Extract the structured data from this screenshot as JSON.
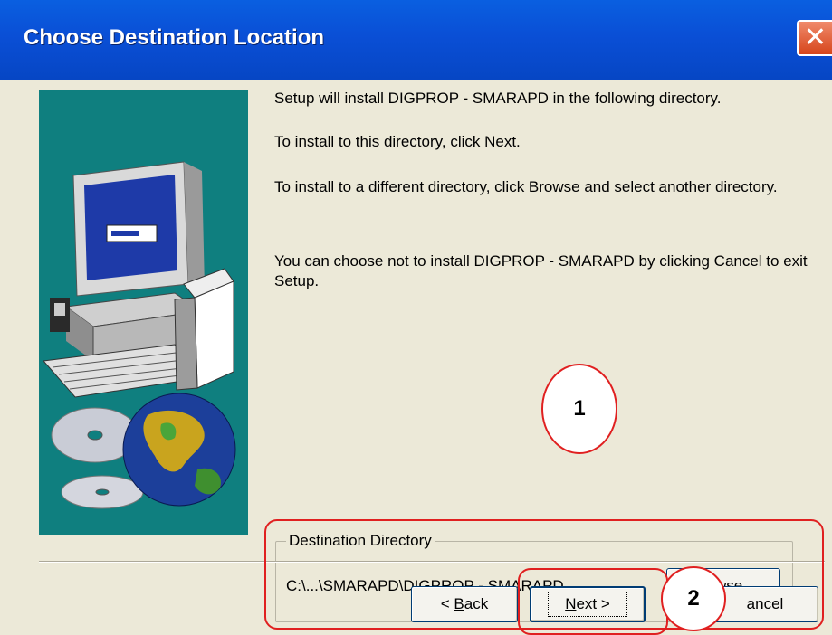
{
  "window": {
    "title": "Choose Destination Location",
    "close_glyph": "✕"
  },
  "description": {
    "line1": "Setup will install DIGPROP - SMARAPD in the following directory.",
    "line2": "To install to this directory, click Next.",
    "line3": "To install to a different directory, click Browse and select another directory.",
    "line4": "You can choose not to install DIGPROP - SMARAPD by clicking Cancel to exit Setup."
  },
  "destination": {
    "group_label": "Destination Directory",
    "path": "C:\\...\\SMARAPD\\DIGPROP - SMARAPD",
    "browse_prefix": "B",
    "browse_accel": "r",
    "browse_suffix": "owse..."
  },
  "buttons": {
    "back_lt": "< ",
    "back_accel": "B",
    "back_rest": "ack",
    "next_accel": "N",
    "next_rest": "ext >",
    "cancel_label": "ancel"
  },
  "annotations": {
    "marker1": "1",
    "marker2": "2",
    "color": "#e02020"
  },
  "colors": {
    "titlebar": "#0a4fd6",
    "dialog_bg": "#ece9d8",
    "side_art_bg": "#0f7f7f"
  }
}
